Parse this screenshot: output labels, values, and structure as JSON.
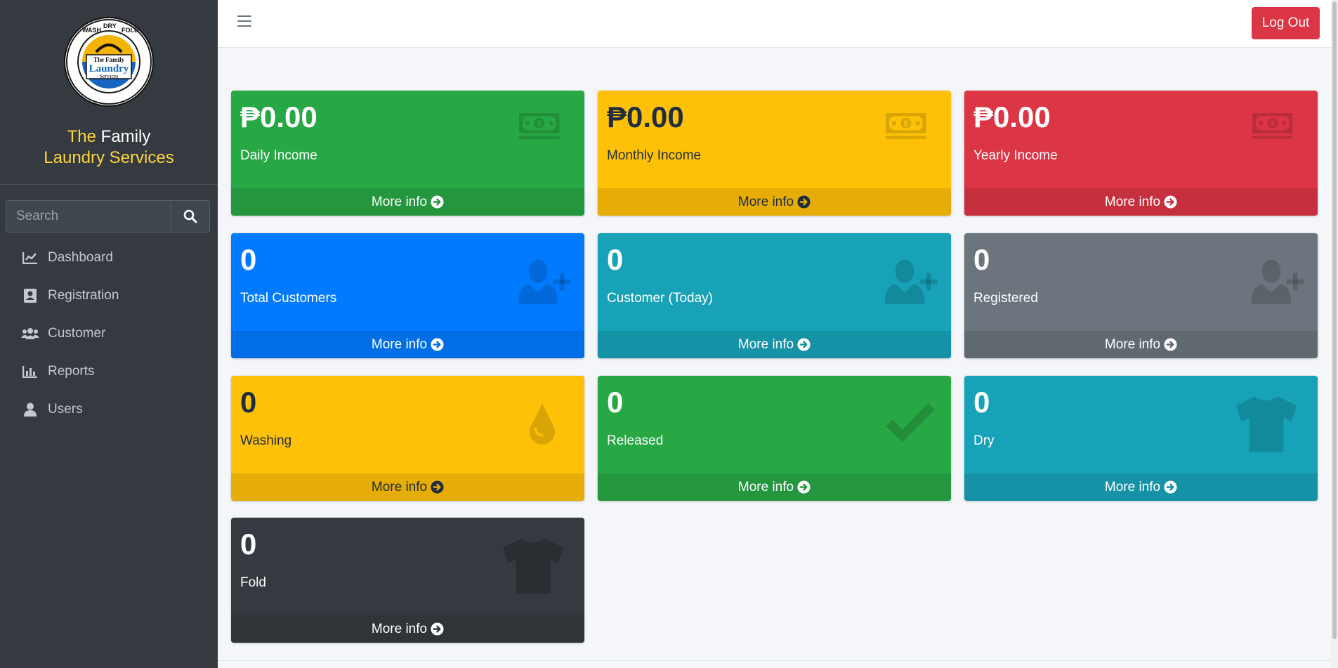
{
  "brand": {
    "logo_text": [
      "WASH",
      "DRY",
      "FOLD",
      "The Family",
      "Laundry",
      "Services"
    ],
    "name_the": "The",
    "name_family": " Family",
    "name_line2": "Laundry Services"
  },
  "search": {
    "placeholder": "Search"
  },
  "nav": [
    {
      "label": "Dashboard",
      "icon": "chart-line-icon"
    },
    {
      "label": "Registration",
      "icon": "address-card-icon"
    },
    {
      "label": "Customer",
      "icon": "users-icon"
    },
    {
      "label": "Reports",
      "icon": "bar-chart-icon"
    },
    {
      "label": "Users",
      "icon": "user-icon"
    }
  ],
  "header": {
    "logout_label": "Log Out"
  },
  "cards": [
    {
      "value": "₱0.00",
      "label": "Daily Income",
      "more": "More info",
      "icon": "money-bill-icon",
      "color": "#28a745"
    },
    {
      "value": "₱0.00",
      "label": "Monthly Income",
      "more": "More info",
      "icon": "money-bill-icon",
      "color": "#ffc107"
    },
    {
      "value": "₱0.00",
      "label": "Yearly Income",
      "more": "More info",
      "icon": "money-bill-icon",
      "color": "#dc3545"
    },
    {
      "value": "0",
      "label": "Total Customers",
      "more": "More info",
      "icon": "user-plus-icon",
      "color": "#007bff"
    },
    {
      "value": "0",
      "label": "Customer (Today)",
      "more": "More info",
      "icon": "user-plus-icon",
      "color": "#17a2b8"
    },
    {
      "value": "0",
      "label": "Registered",
      "more": "More info",
      "icon": "user-plus-icon",
      "color": "#6c757d"
    },
    {
      "value": "0",
      "label": "Washing",
      "more": "More info",
      "icon": "tint-icon",
      "color": "#ffc107"
    },
    {
      "value": "0",
      "label": "Released",
      "more": "More info",
      "icon": "check-icon",
      "color": "#28a745"
    },
    {
      "value": "0",
      "label": "Dry",
      "more": "More info",
      "icon": "tshirt-icon",
      "color": "#17a2b8"
    },
    {
      "value": "0",
      "label": "Fold",
      "more": "More info",
      "icon": "tshirt-icon",
      "color": "#343a40"
    }
  ]
}
